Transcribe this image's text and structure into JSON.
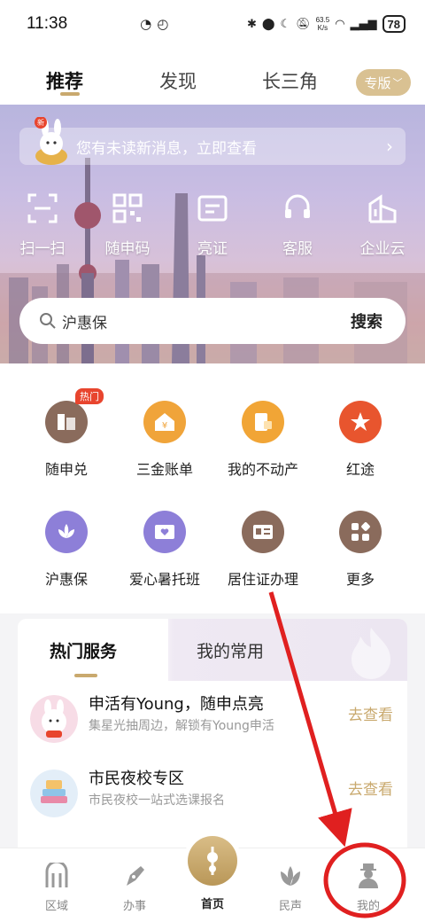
{
  "status": {
    "time": "11:38",
    "speed_value": "63.5",
    "speed_unit": "K/s",
    "battery": "78"
  },
  "top_tabs": [
    {
      "label": "推荐"
    },
    {
      "label": "发现"
    },
    {
      "label": "长三角"
    }
  ],
  "edition_label": "专版",
  "notice": {
    "badge": "新",
    "text": "您有未读新消息，立即查看"
  },
  "quick_actions": [
    {
      "label": "扫一扫",
      "icon": "scan-icon"
    },
    {
      "label": "随申码",
      "icon": "qr-code-icon"
    },
    {
      "label": "亮证",
      "icon": "card-icon"
    },
    {
      "label": "客服",
      "icon": "headset-icon"
    },
    {
      "label": "企业云",
      "icon": "building-icon"
    }
  ],
  "search": {
    "placeholder": "沪惠保",
    "button": "搜索"
  },
  "services": [
    {
      "label": "随申兑",
      "badge": "热门",
      "color": "#8a6b5c"
    },
    {
      "label": "三金账单",
      "color": "#f0a43a"
    },
    {
      "label": "我的不动产",
      "color": "#f1a536"
    },
    {
      "label": "红途",
      "color": "#e8552e"
    },
    {
      "label": "沪惠保",
      "color": "#8d7fd8"
    },
    {
      "label": "爱心暑托班",
      "color": "#8d7fd8"
    },
    {
      "label": "居住证办理",
      "color": "#8a6b5c"
    },
    {
      "label": "更多",
      "color": "#8a6b5c"
    }
  ],
  "card": {
    "tabs": [
      "热门服务",
      "我的常用"
    ],
    "rows": [
      {
        "title": "申活有Young，随申点亮",
        "subtitle": "集星光抽周边，解锁有Young申活",
        "action": "去查看"
      },
      {
        "title": "市民夜校专区",
        "subtitle": "市民夜校一站式选课报名",
        "action": "去查看"
      }
    ]
  },
  "bottom_nav": [
    {
      "label": "区域",
      "icon": "region-icon"
    },
    {
      "label": "办事",
      "icon": "pen-icon"
    },
    {
      "label": "首页",
      "icon": "home-tower-icon"
    },
    {
      "label": "民声",
      "icon": "lotus-icon"
    },
    {
      "label": "我的",
      "icon": "person-icon"
    }
  ],
  "colors": {
    "gold": "#c9a96e",
    "annotation_red": "#e02020"
  }
}
